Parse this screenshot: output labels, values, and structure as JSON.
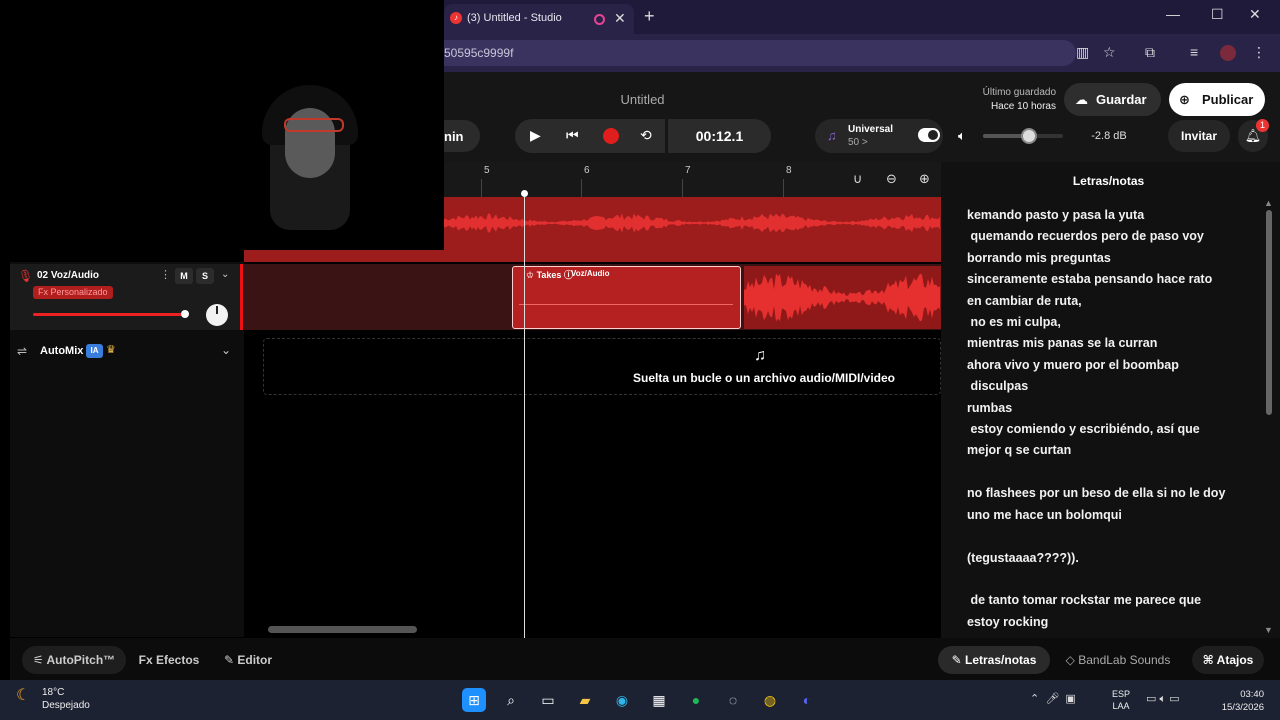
{
  "browser": {
    "tab_title": "(3) Untitled - Studio",
    "url_fragment": "50595c9999f",
    "new_tab": "+",
    "window_buttons": [
      "—",
      "☐",
      "✕"
    ]
  },
  "header": {
    "project_title": "Untitled",
    "last_saved_label": "Último guardado",
    "last_saved_time": "Hace 10 horas",
    "save_label": "Guardar",
    "publish_label": "Publicar"
  },
  "transport": {
    "left_pill": "nin",
    "time": "00:12.1",
    "key_name": "Universal",
    "key_sub": "50 >",
    "master_db": "-2.8 dB",
    "invite_label": "Invitar",
    "notifications_count": "1",
    "master_volume_level": 0.58
  },
  "ruler": {
    "marks": [
      "5",
      "6",
      "7",
      "8"
    ]
  },
  "tracks": {
    "track2": {
      "name": "02  Voz/Audio",
      "fx": "Fx Personalizado",
      "mute": "M",
      "solo": "S",
      "clip_takes": "Takes",
      "clip_name": "Voz/Audio"
    },
    "automix": {
      "label": "AutoMix",
      "badge": "IA"
    },
    "drop_text": "Suelta un bucle o un archivo audio/MIDI/video"
  },
  "lyrics_panel": {
    "title": "Letras/notas",
    "text": "kemando pasto y pasa la yuta\n quemando recuerdos pero de paso voy\nborrando mis preguntas\nsinceramente estaba pensando hace rato\nen cambiar de ruta,\n no es mi culpa,\nmientras mis panas se la curran\nahora vivo y muero por el boombap\n disculpas\nrumbas\n estoy comiendo y escribiéndo, así que\nmejor q se curtan\n\nno flashees por un beso de ella si no le doy\nuno me hace un bolomqui\n\n(tegustaaaa????)).\n\n de tanto tomar rockstar me parece que\nestoy rocking"
  },
  "bottom_bar": {
    "autopitch": "AutoPitch™",
    "efectos": "Efectos",
    "editor": "Editor",
    "letras": "Letras/notas",
    "sounds": "BandLab Sounds",
    "atajos": "Atajos"
  },
  "taskbar": {
    "temp": "18°C",
    "weather": "Despejado",
    "lang1": "ESP",
    "lang2": "LAA",
    "time": "03:40",
    "date": "15/3/2026"
  },
  "colors": {
    "track_red": "#9d1c1c",
    "clip_red": "#b52020",
    "accent_purple": "#8a63d2"
  }
}
